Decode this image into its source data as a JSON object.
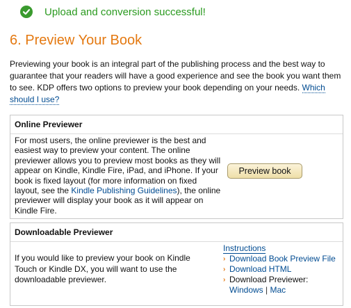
{
  "status": {
    "message": "Upload and conversion successful!"
  },
  "heading": "6. Preview Your Book",
  "intro": {
    "text": "Previewing your book is an integral part of the publishing process and the best way to guarantee that your readers will have a good experience and see the book you want them to see. KDP offers two options to preview your book depending on your needs.",
    "link": "Which should I use?"
  },
  "online_previewer": {
    "title": "Online Previewer",
    "text_before_link": "For most users, the online previewer is the best and easiest way to preview your content. The online previewer allows you to preview most books as they will appear on Kindle, Kindle Fire, iPad, and iPhone. If your book is fixed layout (for more information on fixed layout, see the",
    "link": "Kindle Publishing Guidelines",
    "text_after_link": "), the online previewer will display your book as it will appear on Kindle Fire.",
    "button": "Preview book"
  },
  "downloadable_previewer": {
    "title": "Downloadable Previewer",
    "text": "If you would like to preview your book on Kindle Touch or Kindle DX, you will want to use the downloadable previewer.",
    "instructions": "Instructions",
    "links": {
      "book_preview_file": "Download Book Preview File",
      "html": "Download HTML",
      "previewer_label": "Download Previewer:",
      "windows": "Windows",
      "separator": "|",
      "mac": "Mac"
    }
  },
  "colors": {
    "success_green": "#2a9a1f",
    "heading_orange": "#e47911",
    "link_blue": "#004b91"
  }
}
